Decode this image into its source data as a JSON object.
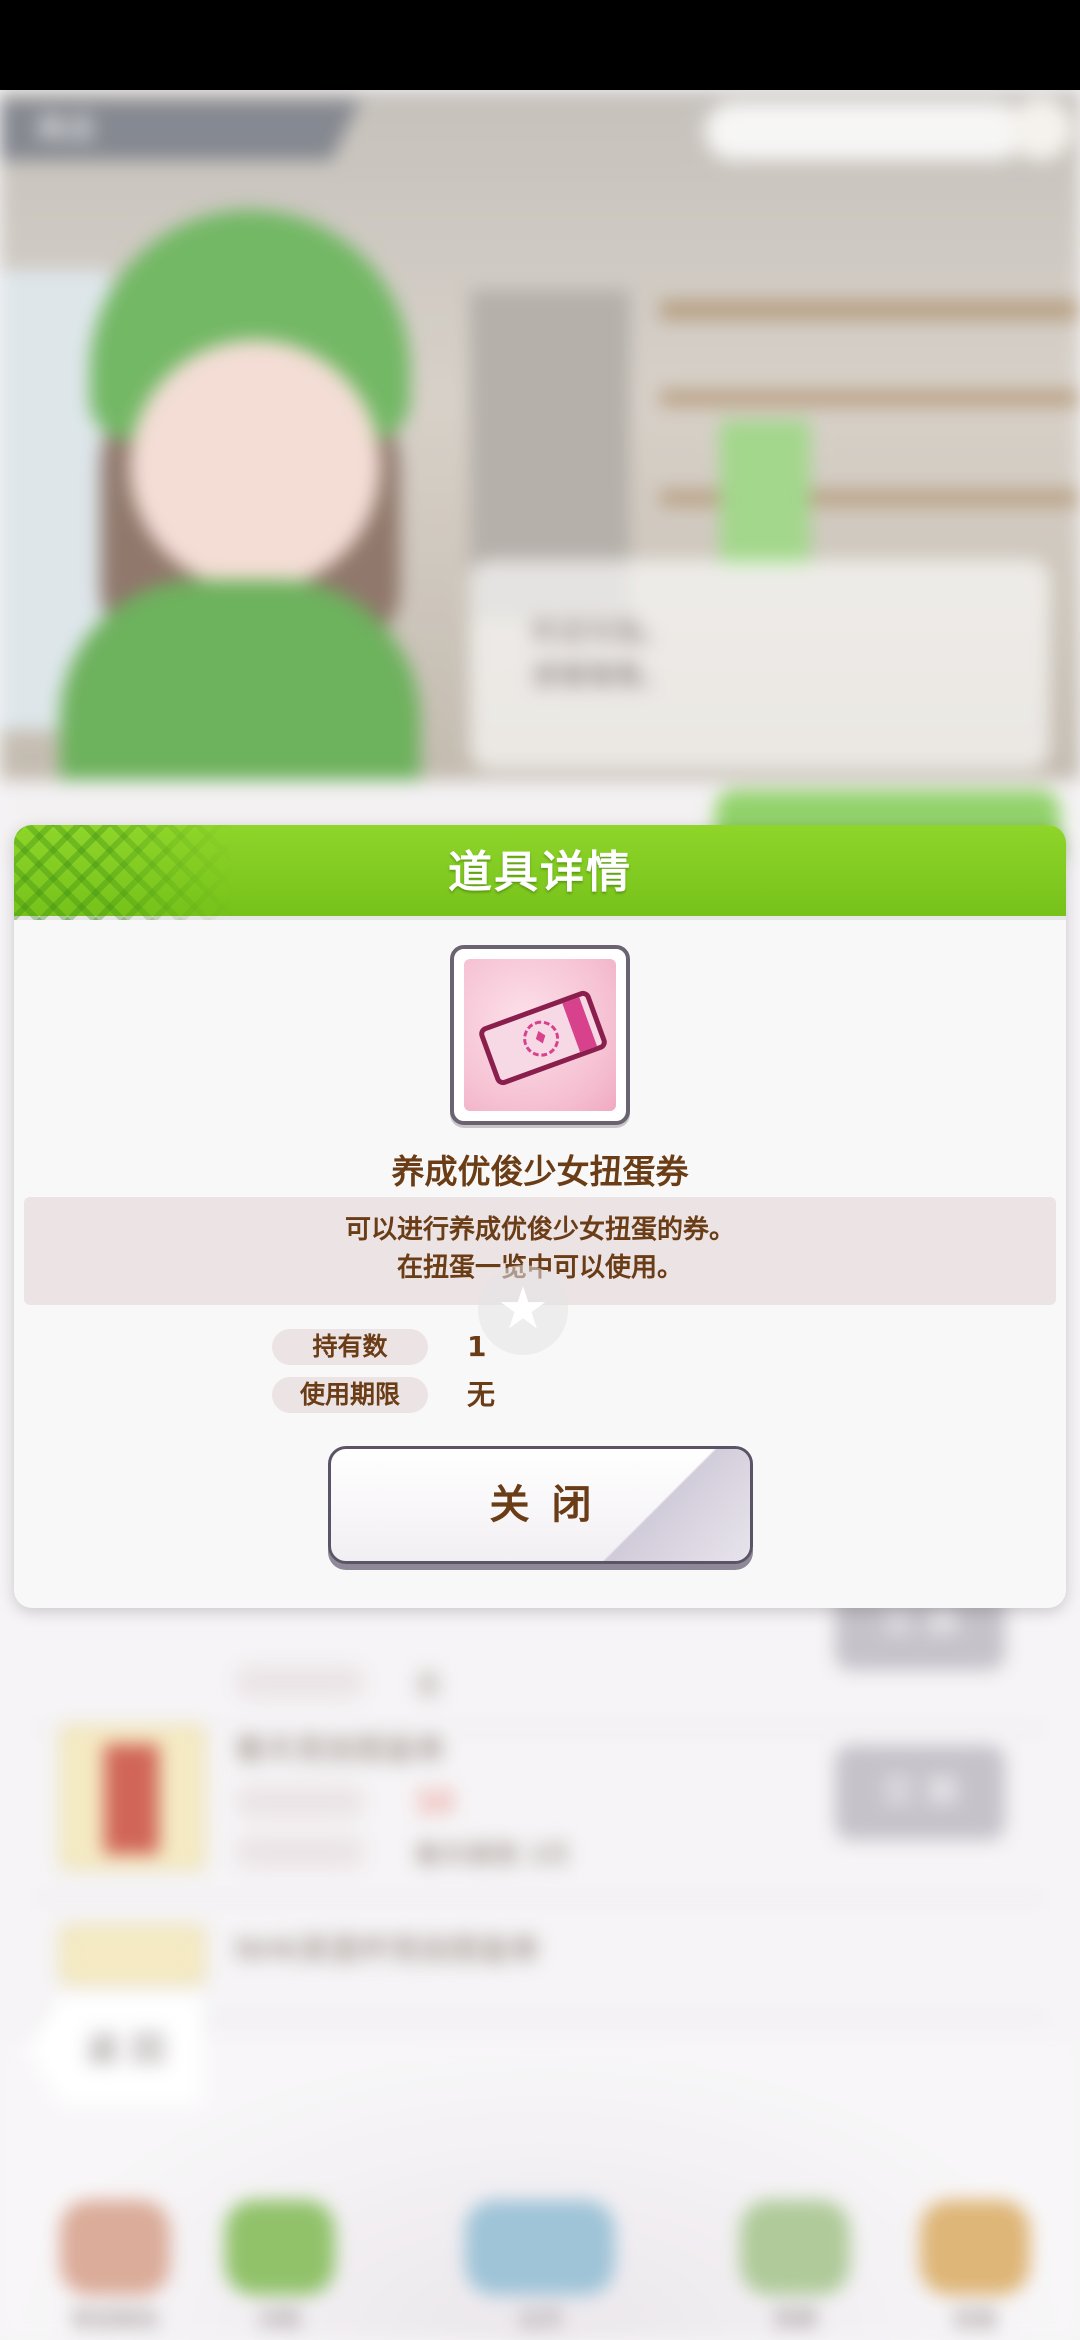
{
  "background": {
    "top_label": "商店",
    "bubble_text": [
      "欢迎光临。",
      "请慢慢看。"
    ],
    "list_rows": [
      {
        "title": "",
        "label_b": "交换期限",
        "value_b": "无",
        "button": "交 换"
      },
      {
        "title": "春天竞技图鉴券",
        "label_a": "消耗",
        "value_a": "10",
        "label_b": "交换期限",
        "value_b": "春天期限 3月",
        "button": "交 换"
      },
      {
        "title": "NHK英里杯竞技图鉴券"
      }
    ],
    "back_label": "返 回",
    "nav": [
      "育成角色",
      "训练",
      "主页",
      "竞赛",
      "扭蛋"
    ]
  },
  "dialog": {
    "title": "道具详情",
    "item_icon": "gacha-ticket-icon",
    "item_name": "养成优俊少女扭蛋券",
    "description": [
      "可以进行养成优俊少女扭蛋的券。",
      "在扭蛋一览中可以使用。"
    ],
    "stats": [
      {
        "label": "持有数",
        "value": "1"
      },
      {
        "label": "使用期限",
        "value": "无"
      }
    ],
    "close_label": "关闭"
  },
  "colors": {
    "header_green": "#7ac31c",
    "text_brown": "#6b3d17",
    "pill_bg": "#ece3e4"
  }
}
